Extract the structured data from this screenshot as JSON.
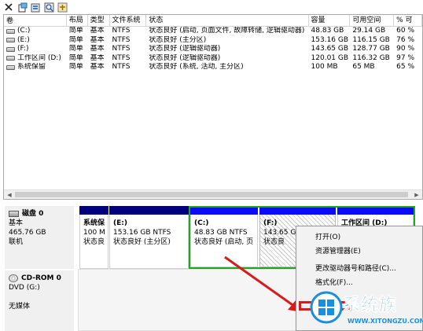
{
  "list": {
    "columns": [
      "卷",
      "布局",
      "类型",
      "文件系统",
      "状态",
      "容量",
      "可用空间",
      "% 可"
    ],
    "rows": [
      [
        "(C:)",
        "简单",
        "基本",
        "NTFS",
        "状态良好 (启动, 页面文件, 故障转储, 逻辑驱动器)",
        "48.83 GB",
        "29.14 GB",
        "60 %"
      ],
      [
        "(E:)",
        "简单",
        "基本",
        "NTFS",
        "状态良好 (主分区)",
        "153.16 GB",
        "116.15 GB",
        "76 %"
      ],
      [
        "(F:)",
        "简单",
        "基本",
        "NTFS",
        "状态良好 (逻辑驱动器)",
        "143.65 GB",
        "128.77 GB",
        "90 %"
      ],
      [
        "工作区间 (D:)",
        "简单",
        "基本",
        "NTFS",
        "状态良好 (逻辑驱动器)",
        "120.01 GB",
        "116.32 GB",
        "97 %"
      ],
      [
        "系统保留",
        "简单",
        "基本",
        "NTFS",
        "状态良好 (系统, 活动, 主分区)",
        "100 MB",
        "65 MB",
        "65 %"
      ]
    ]
  },
  "disk0": {
    "name": "磁盘 0",
    "type": "基本",
    "size": "465.76 GB",
    "status": "联机"
  },
  "partitions": [
    {
      "title": "系统保",
      "line2": "100 M",
      "line3": "状态良"
    },
    {
      "title": "(E:)",
      "line2": "153.16 GB NTFS",
      "line3": "状态良好 (主分区)"
    },
    {
      "title": "(C:)",
      "line2": "48.83 GB NTFS",
      "line3": "状态良好 (启动, 页"
    },
    {
      "title": "(F:)",
      "line2": "143.65 G",
      "line3": "状态良"
    },
    {
      "title": "工作区间  (D:)",
      "line2": "",
      "line3": ""
    }
  ],
  "cdrom": {
    "name": "CD-ROM 0",
    "type": "DVD (G:)",
    "status": "无媒体"
  },
  "context_menu": {
    "items": [
      "打开(O)",
      "资源管理器(E)",
      "更改驱动器号和路径(C)...",
      "格式化(F)..."
    ]
  },
  "watermark": {
    "name": "系统族",
    "url": "WWW.XITONGZU.COM"
  },
  "colors": {
    "partition_bar": "#00007f",
    "selected_border": "#22a622",
    "highlight_red": "#d81b1b",
    "watermark_blue": "#1a8fe0"
  },
  "icons": [
    "back-arrow-icon",
    "properties-icon",
    "help-icon",
    "search-icon",
    "settings-icon"
  ]
}
